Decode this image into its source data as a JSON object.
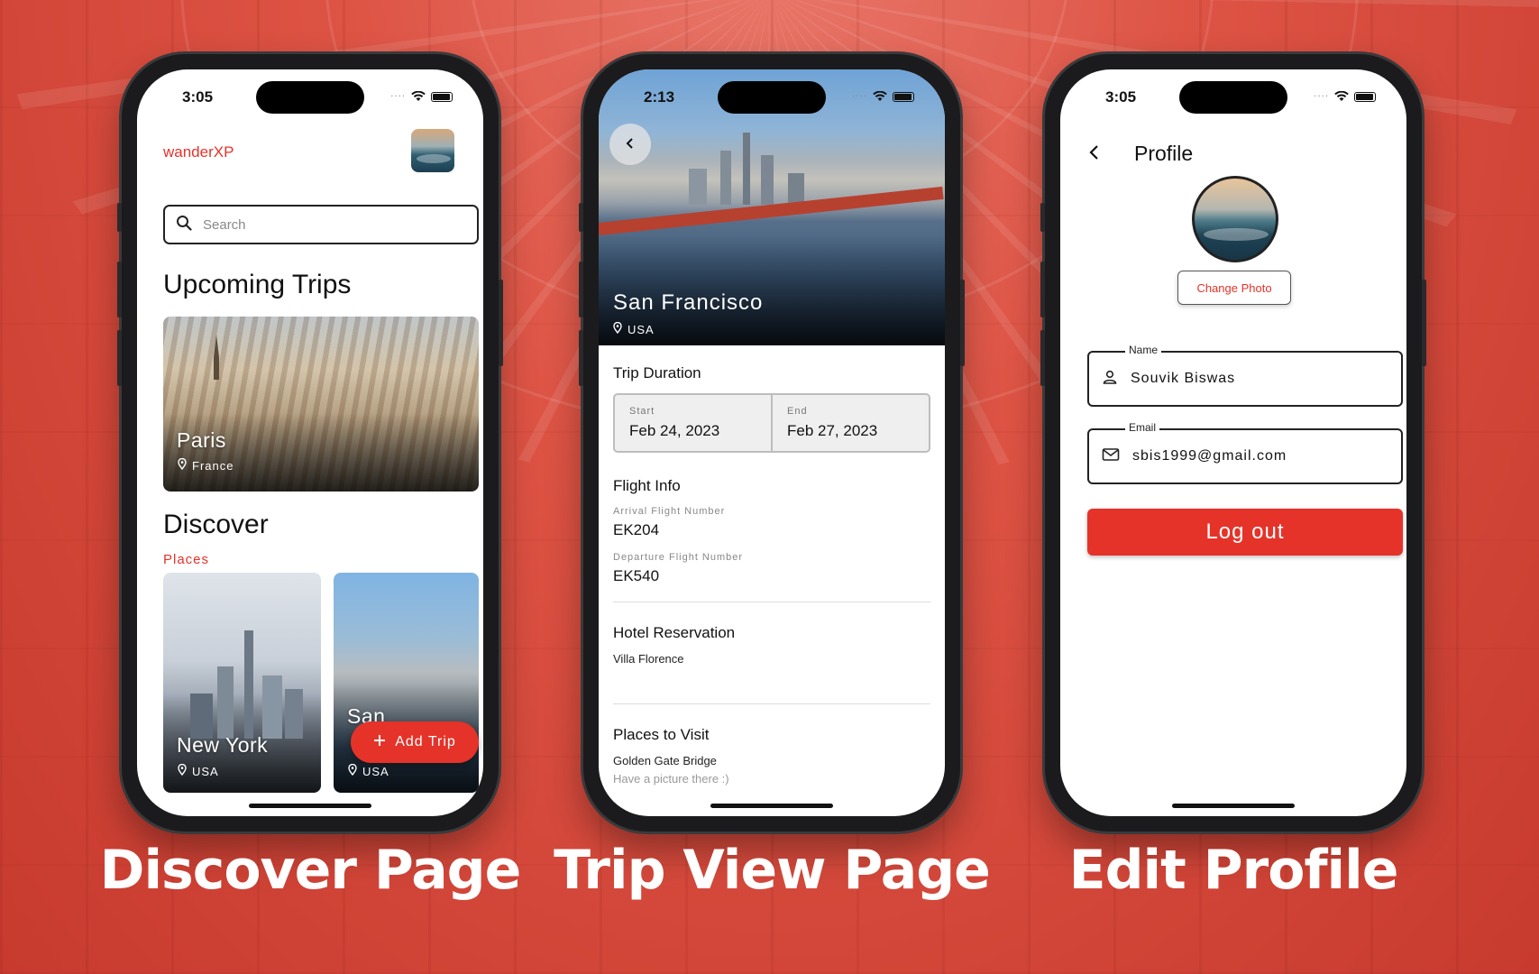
{
  "colors": {
    "accent": "#e5332a",
    "background": "#d9473a"
  },
  "captions": {
    "discover": "Discover Page",
    "trip_view": "Trip View Page",
    "edit_profile": "Edit Profile"
  },
  "discover": {
    "status_time": "3:05",
    "brand": "wanderXP",
    "search_placeholder": "Search",
    "upcoming_title": "Upcoming Trips",
    "upcoming": {
      "city": "Paris",
      "country": "France"
    },
    "discover_title": "Discover",
    "places_label": "Places",
    "places": [
      {
        "city": "New York",
        "country": "USA"
      },
      {
        "city": "San",
        "country": "USA"
      }
    ],
    "fab_label": "Add Trip"
  },
  "trip": {
    "status_time": "2:13",
    "city": "San Francisco",
    "country": "USA",
    "duration_title": "Trip Duration",
    "start_label": "Start",
    "start_date": "Feb 24, 2023",
    "end_label": "End",
    "end_date": "Feb 27, 2023",
    "flight_title": "Flight Info",
    "arrival_label": "Arrival Flight Number",
    "arrival_value": "EK204",
    "departure_label": "Departure Flight Number",
    "departure_value": "EK540",
    "hotel_title": "Hotel Reservation",
    "hotel_value": "Villa Florence",
    "places_title": "Places to Visit",
    "place_name": "Golden Gate Bridge",
    "place_note": "Have a picture there :)"
  },
  "profile": {
    "status_time": "3:05",
    "title": "Profile",
    "change_photo": "Change Photo",
    "name_label": "Name",
    "name_value": "Souvik Biswas",
    "email_label": "Email",
    "email_value": "sbis1999@gmail.com",
    "logout_label": "Log out"
  }
}
